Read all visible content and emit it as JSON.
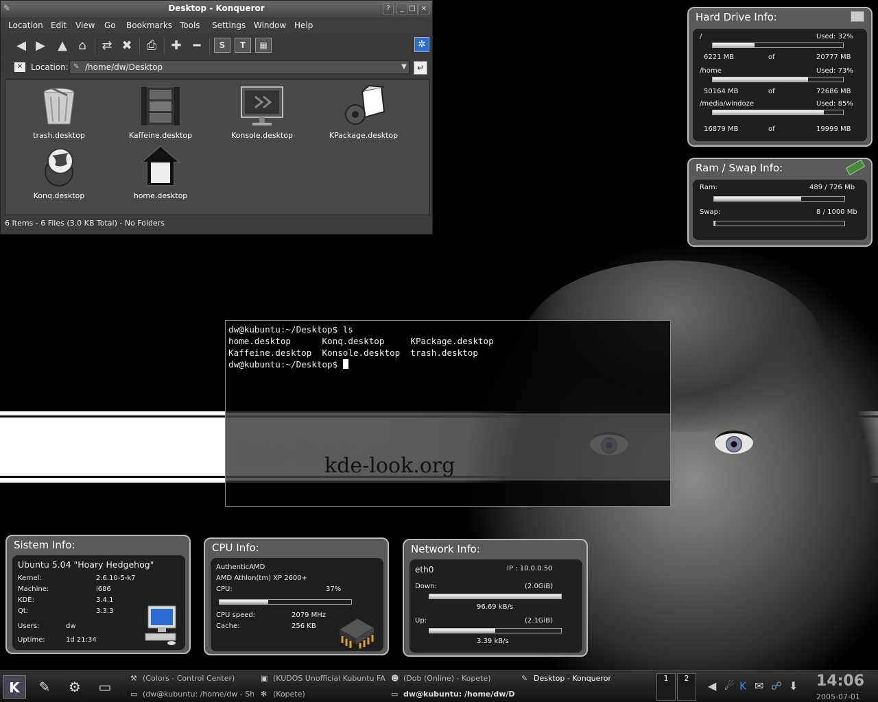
{
  "konqueror": {
    "title": "Desktop - Konqueror",
    "menus": [
      "Location",
      "Edit",
      "View",
      "Go",
      "Bookmarks",
      "Tools",
      "Settings",
      "Window",
      "Help"
    ],
    "location_label": "Location:",
    "location_value": "/home/dw/Desktop",
    "files": [
      "trash.desktop",
      "Kaffeine.desktop",
      "Konsole.desktop",
      "KPackage.desktop",
      "Konq.desktop",
      "home.desktop"
    ],
    "status": "6 Items - 6 Files (3.0 KB Total) - No Folders",
    "title_buttons": [
      "?",
      "_",
      "□",
      "×"
    ],
    "toolbar_text_buttons": [
      "S",
      "T"
    ]
  },
  "terminal": {
    "lines": [
      "dw@kubuntu:~/Desktop$ ls",
      "home.desktop      Konq.desktop     KPackage.desktop",
      "Kaffeine.desktop  Konsole.desktop  trash.desktop",
      "dw@kubuntu:~/Desktop$ "
    ]
  },
  "wallpaper": {
    "logo": "kde-look.org"
  },
  "hard_drive": {
    "title": "Hard Drive Info:",
    "of_label": "of",
    "drives": [
      {
        "mount": "/",
        "used_label": "Used: 32%",
        "used_pct": 32,
        "used": "6221 MB",
        "total": "20777 MB"
      },
      {
        "mount": "/home",
        "used_label": "Used: 73%",
        "used_pct": 73,
        "used": "50164 MB",
        "total": "72686 MB"
      },
      {
        "mount": "/media/windoze",
        "used_label": "Used: 85%",
        "used_pct": 85,
        "used": "16879 MB",
        "total": "19999 MB"
      }
    ]
  },
  "ram_swap": {
    "title": "Ram / Swap Info:",
    "ram_label": "Ram:",
    "ram_value": "489 / 726 Mb",
    "ram_pct": 67,
    "swap_label": "Swap:",
    "swap_value": "8 / 1000 Mb",
    "swap_pct": 1
  },
  "system": {
    "title": "Sistem Info:",
    "distro": "Ubuntu 5.04 \"Hoary Hedgehog\"",
    "rows": [
      {
        "label": "Kernel:",
        "value": "2.6.10-5-k7"
      },
      {
        "label": "Machine:",
        "value": "i686"
      },
      {
        "label": "KDE:",
        "value": "3.4.1"
      },
      {
        "label": "Qt:",
        "value": "3.3.3"
      },
      {
        "label": "Users:",
        "value": "dw"
      },
      {
        "label": "Uptime:",
        "value": "1d 21:34"
      }
    ]
  },
  "cpu": {
    "title": "CPU Info:",
    "vendor": "AuthenticAMD",
    "model": "AMD Athlon(tm) XP 2600+",
    "cpu_label": "CPU:",
    "cpu_value": "37%",
    "cpu_pct": 37,
    "speed_label": "CPU speed:",
    "speed_value": "2079 MHz",
    "cache_label": "Cache:",
    "cache_value": "256 KB"
  },
  "network": {
    "title": "Network Info:",
    "iface": "eth0",
    "ip": "IP : 10.0.0.50",
    "down_label": "Down:",
    "down_total": "(2.0GiB)",
    "down_rate": "96.69 kB/s",
    "down_pct": 100,
    "up_label": "Up:",
    "up_total": "(2.1GiB)",
    "up_rate": "3.39 kB/s",
    "up_pct": 50
  },
  "taskbar": {
    "tasks_row1": [
      "(Colors - Control Center)",
      "(KUDOS Unofficial Kubuntu FA",
      "(Dob (Online) - Kopete)",
      "Desktop - Konqueror"
    ],
    "tasks_row2": [
      "(dw@kubuntu: /home/dw - Sh",
      "(Kopete)",
      "dw@kubuntu: /home/dw/D"
    ],
    "pager": [
      "1",
      "2"
    ],
    "clock_time": "14:06",
    "clock_date": "2005-07-01"
  }
}
